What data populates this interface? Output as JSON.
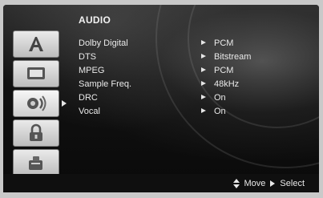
{
  "menu": {
    "title": "AUDIO",
    "items": [
      {
        "label": "Dolby Digital",
        "value": "PCM"
      },
      {
        "label": "DTS",
        "value": "Bitstream"
      },
      {
        "label": "MPEG",
        "value": "PCM"
      },
      {
        "label": "Sample Freq.",
        "value": "48kHz"
      },
      {
        "label": "DRC",
        "value": "On"
      },
      {
        "label": "Vocal",
        "value": "On"
      }
    ]
  },
  "sidebar": {
    "icons": [
      "language-icon",
      "display-icon",
      "audio-icon",
      "lock-icon",
      "others-icon"
    ],
    "active_index": 2
  },
  "footer": {
    "move_label": "Move",
    "select_label": "Select"
  }
}
